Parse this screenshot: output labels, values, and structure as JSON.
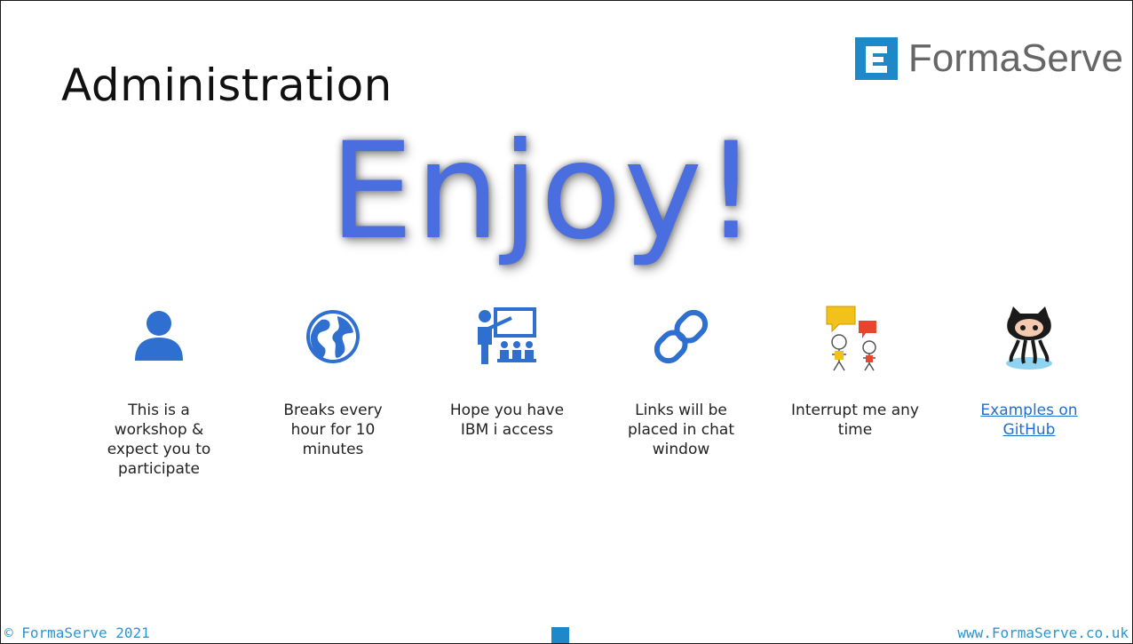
{
  "slide": {
    "title": "Administration",
    "brand": {
      "name": "FormaServe",
      "icon": "formaserve-logo-icon",
      "color": "#1e88c8"
    },
    "headline": "Enjoy!",
    "headline_color": "#4a6ee0",
    "items": [
      {
        "icon": "person-icon",
        "caption": "This is a workshop & expect you to participate"
      },
      {
        "icon": "globe-icon",
        "caption": "Breaks every hour for 10 minutes"
      },
      {
        "icon": "presentation-icon",
        "caption": "Hope you have IBM i access"
      },
      {
        "icon": "link-icon",
        "caption": "Links will be placed in chat window"
      },
      {
        "icon": "conversation-icon",
        "caption": "Interrupt me any time"
      },
      {
        "icon": "github-octocat-icon",
        "caption": "Examples on GitHub",
        "link": true
      }
    ],
    "footer": {
      "copyright": "© FormaServe 2021",
      "url": "www.FormaServe.co.uk"
    }
  }
}
